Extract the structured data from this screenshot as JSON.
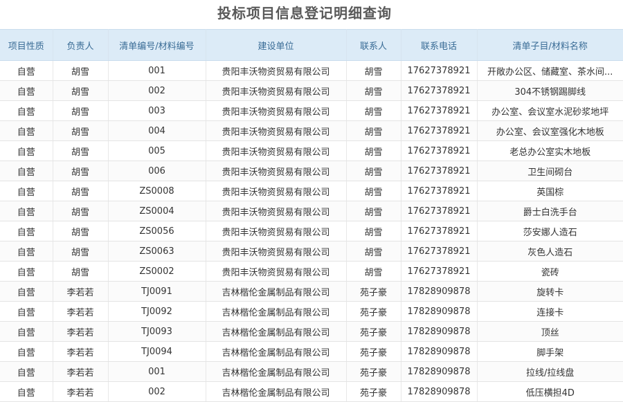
{
  "page": {
    "title": "投标项目信息登记明细查询"
  },
  "table": {
    "columns": [
      "项目性质",
      "负责人",
      "清单编号/材料编号",
      "建设单位",
      "联系人",
      "联系电话",
      "清单子目/材料名称"
    ],
    "rows": [
      [
        "自营",
        "胡雪",
        "001",
        "贵阳丰沃物资贸易有限公司",
        "胡雪",
        "17627378921",
        "开敞办公区、储藏室、茶水间..."
      ],
      [
        "自营",
        "胡雪",
        "002",
        "贵阳丰沃物资贸易有限公司",
        "胡雪",
        "17627378921",
        "304不锈钢踢脚线"
      ],
      [
        "自营",
        "胡雪",
        "003",
        "贵阳丰沃物资贸易有限公司",
        "胡雪",
        "17627378921",
        "办公室、会议室水泥砂浆地坪"
      ],
      [
        "自营",
        "胡雪",
        "004",
        "贵阳丰沃物资贸易有限公司",
        "胡雪",
        "17627378921",
        "办公室、会议室强化木地板"
      ],
      [
        "自营",
        "胡雪",
        "005",
        "贵阳丰沃物资贸易有限公司",
        "胡雪",
        "17627378921",
        "老总办公室实木地板"
      ],
      [
        "自营",
        "胡雪",
        "006",
        "贵阳丰沃物资贸易有限公司",
        "胡雪",
        "17627378921",
        "卫生间砌台"
      ],
      [
        "自营",
        "胡雪",
        "ZS0008",
        "贵阳丰沃物资贸易有限公司",
        "胡雪",
        "17627378921",
        "英国棕"
      ],
      [
        "自营",
        "胡雪",
        "ZS0004",
        "贵阳丰沃物资贸易有限公司",
        "胡雪",
        "17627378921",
        "爵士白洗手台"
      ],
      [
        "自营",
        "胡雪",
        "ZS0056",
        "贵阳丰沃物资贸易有限公司",
        "胡雪",
        "17627378921",
        "莎安娜人造石"
      ],
      [
        "自营",
        "胡雪",
        "ZS0063",
        "贵阳丰沃物资贸易有限公司",
        "胡雪",
        "17627378921",
        "灰色人造石"
      ],
      [
        "自营",
        "胡雪",
        "ZS0002",
        "贵阳丰沃物资贸易有限公司",
        "胡雪",
        "17627378921",
        "瓷砖"
      ],
      [
        "自营",
        "李若若",
        "TJ0091",
        "吉林楷伦金属制品有限公司",
        "苑子豪",
        "17828909878",
        "旋转卡"
      ],
      [
        "自营",
        "李若若",
        "TJ0092",
        "吉林楷伦金属制品有限公司",
        "苑子豪",
        "17828909878",
        "连接卡"
      ],
      [
        "自营",
        "李若若",
        "TJ0093",
        "吉林楷伦金属制品有限公司",
        "苑子豪",
        "17828909878",
        "顶丝"
      ],
      [
        "自营",
        "李若若",
        "TJ0094",
        "吉林楷伦金属制品有限公司",
        "苑子豪",
        "17828909878",
        "脚手架"
      ],
      [
        "自营",
        "李若若",
        "001",
        "吉林楷伦金属制品有限公司",
        "苑子豪",
        "17828909878",
        "拉线/拉线盘"
      ],
      [
        "自营",
        "李若若",
        "002",
        "吉林楷伦金属制品有限公司",
        "苑子豪",
        "17828909878",
        "低压横担4D"
      ]
    ]
  }
}
